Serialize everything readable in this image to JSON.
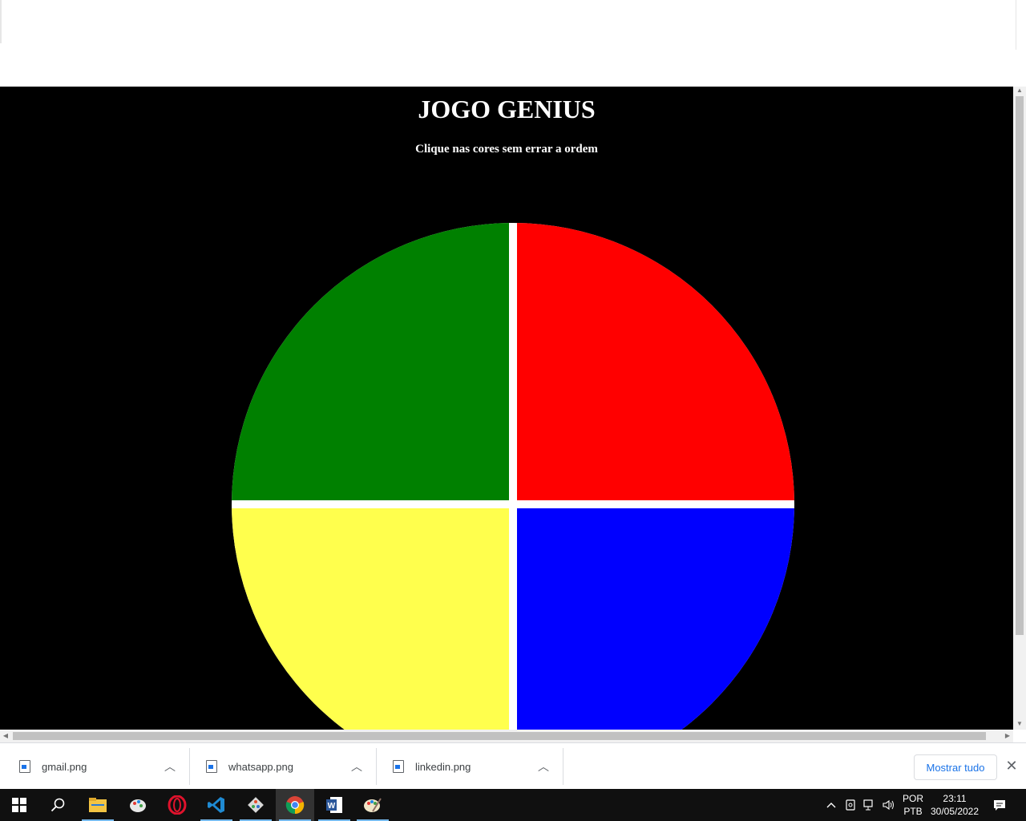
{
  "page": {
    "title": "JOGO GENIUS",
    "subtitle": "Clique nas cores sem errar a ordem"
  },
  "genius": {
    "quadrants": [
      {
        "name": "green",
        "color": "#008000"
      },
      {
        "name": "red",
        "color": "#ff0000"
      },
      {
        "name": "yellow",
        "color": "#ffff4d"
      },
      {
        "name": "blue",
        "color": "#0000ff"
      }
    ]
  },
  "downloads": {
    "items": [
      {
        "name": "gmail.png"
      },
      {
        "name": "whatsapp.png"
      },
      {
        "name": "linkedin.png"
      }
    ],
    "show_all": "Mostrar tudo"
  },
  "taskbar": {
    "apps": [
      "windows-start",
      "search",
      "file-explorer",
      "paint-3d",
      "opera",
      "vscode",
      "git",
      "chrome",
      "word",
      "paint"
    ],
    "language_line1": "POR",
    "language_line2": "PTB",
    "time": "23:11",
    "date": "30/05/2022"
  }
}
